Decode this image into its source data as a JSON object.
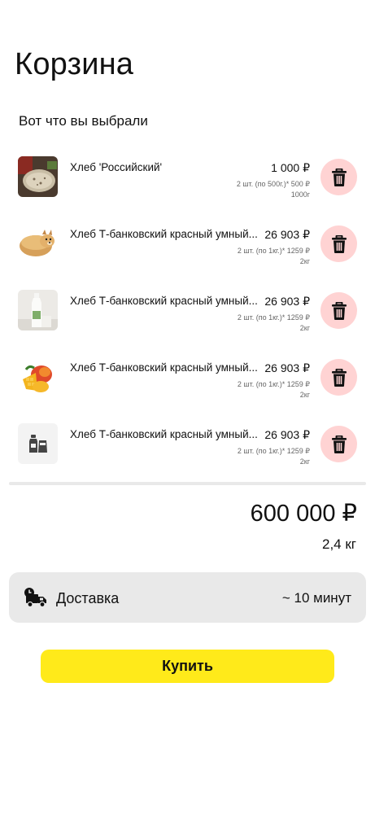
{
  "header": {
    "title": "Корзина"
  },
  "subtitle": "Вот что вы выбрали",
  "cart_items": [
    {
      "name": "Хлеб 'Российский'",
      "price": "1 000 ₽",
      "quantity": "2 шт. (по 500г.)* 500 ₽",
      "weight": "1000г",
      "image_icon": "bread-slice-photo"
    },
    {
      "name": "Хлеб Т-банковский красный умный...",
      "price": "26 903 ₽",
      "quantity": "2 шт. (по 1кг.)* 1259 ₽",
      "weight": "2кг",
      "image_icon": "doge-bread-photo"
    },
    {
      "name": "Хлеб Т-банковский красный умный...",
      "price": "26 903 ₽",
      "quantity": "2 шт. (по 1кг.)* 1259 ₽",
      "weight": "2кг",
      "image_icon": "milk-bottle-photo"
    },
    {
      "name": "Хлеб Т-банковский красный умный...",
      "price": "26 903 ₽",
      "quantity": "2 шт. (по 1кг.)* 1259 ₽",
      "weight": "2кг",
      "image_icon": "mango-photo"
    },
    {
      "name": "Хлеб Т-банковский красный умный...",
      "price": "26 903 ₽",
      "quantity": "2 шт. (по 1кг.)* 1259 ₽",
      "weight": "2кг",
      "image_icon": "product-placeholder-icon"
    }
  ],
  "summary": {
    "total_price": "600 000 ₽",
    "total_weight": "2,4 кг"
  },
  "delivery": {
    "label": "Доставка",
    "time": "~ 10 минут",
    "icon": "delivery-truck-icon"
  },
  "buy_button": {
    "label": "Купить"
  },
  "colors": {
    "delete_bg": "#ffd3d3",
    "buy_button": "#ffea1a",
    "panel_bg": "#e9e9e9"
  }
}
